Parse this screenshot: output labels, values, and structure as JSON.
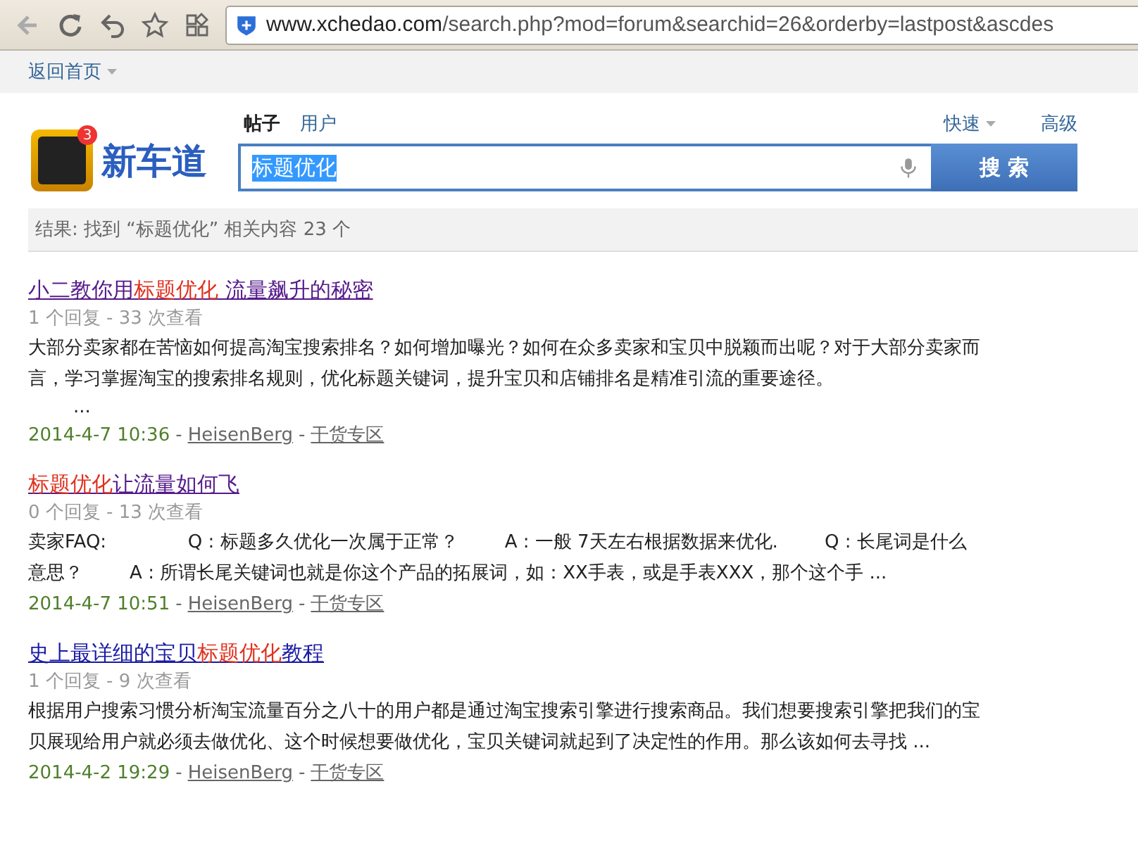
{
  "browser": {
    "url_host": "www.xchedao.com",
    "url_path": "/search.php?mod=forum&searchid=26&orderby=lastpost&ascdes"
  },
  "topnav": {
    "home_link": "返回首页"
  },
  "header": {
    "logo_text": "新车道",
    "logo_badge": "3",
    "tabs": [
      {
        "label": "帖子",
        "selected": true
      },
      {
        "label": "用户",
        "selected": false
      }
    ],
    "quick": "快速",
    "advanced": "高级",
    "query": "标题优化",
    "search_button": "搜 索"
  },
  "summary": "结果: 找到 “标题优化” 相关内容 23 个",
  "results": [
    {
      "visited": true,
      "title_parts": [
        {
          "text": "小二教你用",
          "highlight": false
        },
        {
          "text": "标题优化",
          "highlight": true
        },
        {
          "text": " 流量飙升的秘密",
          "highlight": false
        }
      ],
      "stats": "1 个回复 - 33 次查看",
      "snippet": "大部分卖家都在苦恼如何提高淘宝搜索排名？如何增加曝光？如何在众多卖家和宝贝中脱颖而出呢？对于大部分卖家而言，学习掌握淘宝的搜索排名规则，优化标题关键词，提升宝贝和店铺排名是精准引流的重要途径。",
      "more": "...",
      "date": "2014-4-7 10:36",
      "separators": [
        "-",
        "-"
      ],
      "author": "HeisenBerg",
      "forum": "干货专区"
    },
    {
      "visited": true,
      "title_parts": [
        {
          "text": "标题优化",
          "highlight": true
        },
        {
          "text": "让流量如何飞",
          "highlight": false
        }
      ],
      "stats": "0 个回复 - 13 次查看",
      "snippet": "卖家FAQ:              Q : 标题多久优化一次属于正常？        A : 一般 7天左右根据数据来优化.        Q : 长尾词是什么意思？        A : 所谓长尾关键词也就是你这个产品的拓展词，如：XX手表，或是手表XXX，那个这个手 ...",
      "date": "2014-4-7 10:51",
      "separators": [
        "-",
        "-"
      ],
      "author": "HeisenBerg",
      "forum": "干货专区"
    },
    {
      "visited": false,
      "title_parts": [
        {
          "text": "史上最详细的宝贝",
          "highlight": false
        },
        {
          "text": "标题优化",
          "highlight": true
        },
        {
          "text": "教程",
          "highlight": false
        }
      ],
      "stats": "1 个回复 - 9 次查看",
      "snippet": "根据用户搜索习惯分析淘宝流量百分之八十的用户都是通过淘宝搜索引擎进行搜索商品。我们想要搜索引擎把我们的宝贝展现给用户就必须去做优化、这个时候想要做优化，宝贝关键词就起到了决定性的作用。那么该如何去寻找 ...",
      "date": "2014-4-2 19:29",
      "separators": [
        "-",
        "-"
      ],
      "author": "HeisenBerg",
      "forum": "干货专区"
    }
  ]
}
